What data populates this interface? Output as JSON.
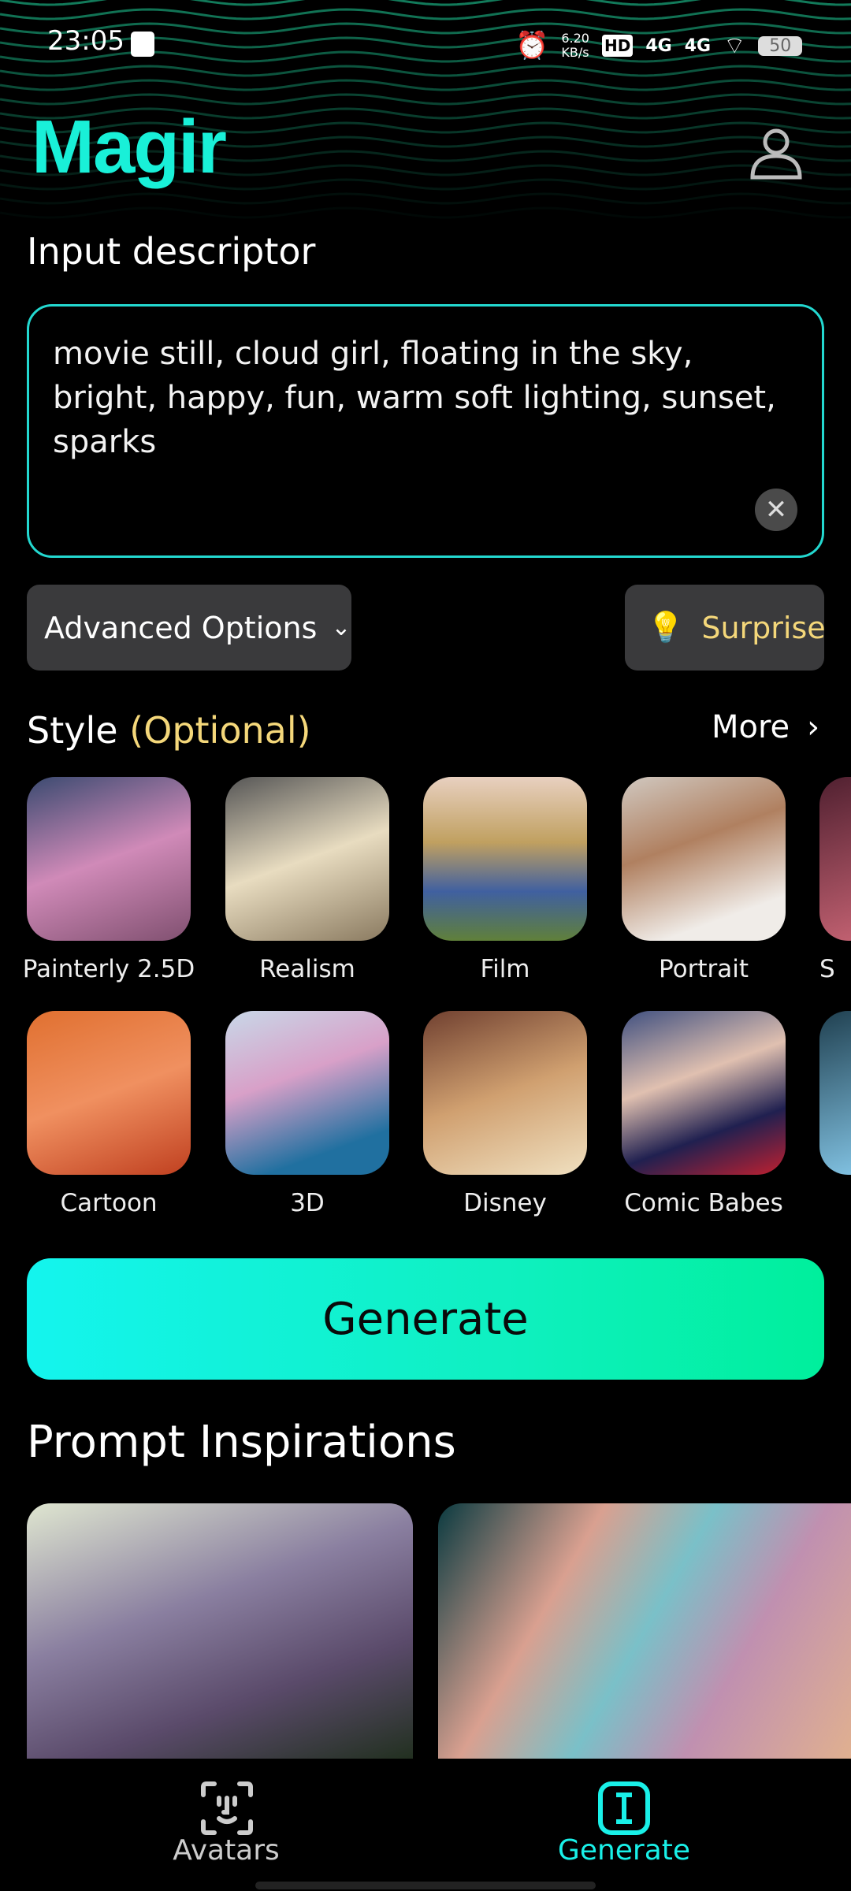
{
  "status": {
    "time": "23:05",
    "speed": "6.20",
    "speed_unit": "KB/s",
    "net1": "4G",
    "net2": "4G",
    "battery": "50"
  },
  "header": {
    "title": "Magir"
  },
  "input": {
    "label": "Input descriptor",
    "value": "movie still, cloud girl, floating in the sky,  bright, happy, fun, warm soft lighting, sunset, sparks"
  },
  "options": {
    "advanced": "Advanced Options",
    "surprise": "Surprise"
  },
  "style": {
    "title": "Style",
    "optional": "(Optional)",
    "more": "More",
    "items": [
      {
        "label": "Painterly 2.5D"
      },
      {
        "label": "Realism"
      },
      {
        "label": "Film"
      },
      {
        "label": "Portrait"
      },
      {
        "label": "S"
      },
      {
        "label": "Cartoon"
      },
      {
        "label": "3D"
      },
      {
        "label": "Disney"
      },
      {
        "label": "Comic Babes"
      }
    ]
  },
  "generate": "Generate",
  "inspirations": {
    "title": "Prompt Inspirations"
  },
  "nav": {
    "avatars": "Avatars",
    "generate": "Generate"
  },
  "colors": {
    "accent": "#19f0d8",
    "gold": "#f4d77a"
  }
}
